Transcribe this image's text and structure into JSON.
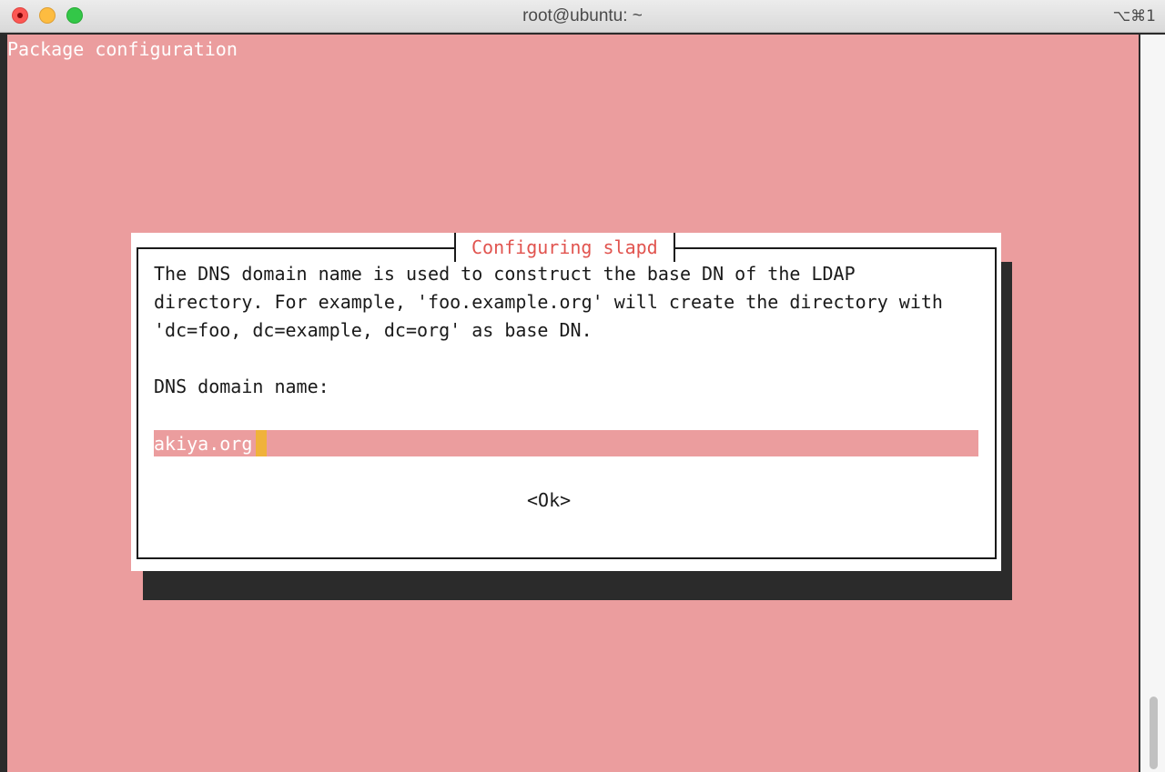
{
  "window": {
    "title": "root@ubuntu: ~",
    "shortcut": "⌥⌘1",
    "controls": [
      "close-icon",
      "minimize-icon",
      "maximize-icon"
    ]
  },
  "terminal": {
    "header": "Package configuration",
    "background_color": "#eb9d9e"
  },
  "dialog": {
    "title": "Configuring slapd",
    "title_color": "#e1544f",
    "message_lines": [
      "The DNS domain name is used to construct the base DN of the LDAP",
      "directory. For example, 'foo.example.org' will create the directory with",
      "'dc=foo, dc=example, dc=org' as base DN."
    ],
    "prompt": "DNS domain name:",
    "input_value": "akiya.org",
    "cursor_color": "#f0b23a",
    "ok_label": "<Ok>"
  }
}
